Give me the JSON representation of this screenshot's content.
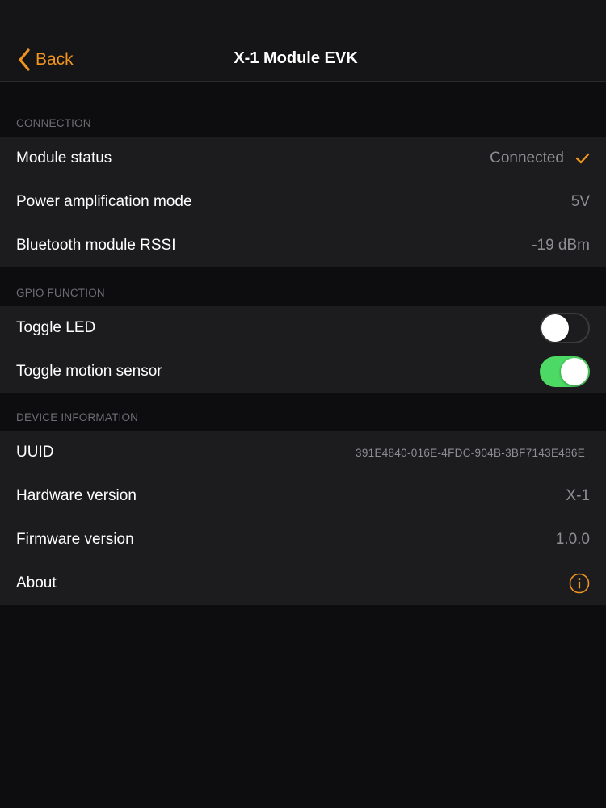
{
  "navbar": {
    "back_label": "Back",
    "title": "X-1 Module EVK"
  },
  "sections": {
    "connection": {
      "header": "CONNECTION",
      "module_status": {
        "label": "Module status",
        "value": "Connected"
      },
      "power_mode": {
        "label": "Power amplification mode",
        "value": "5V"
      },
      "rssi": {
        "label": "Bluetooth module RSSI",
        "value": "-19 dBm"
      }
    },
    "gpio": {
      "header": "GPIO FUNCTION",
      "toggle_led": {
        "label": "Toggle LED",
        "on": false
      },
      "toggle_motion": {
        "label": "Toggle motion sensor",
        "on": true
      }
    },
    "device": {
      "header": "DEVICE INFORMATION",
      "uuid": {
        "label": "UUID",
        "value": "391E4840-016E-4FDC-904B-3BF7143E486E"
      },
      "hardware": {
        "label": "Hardware version",
        "value": "X-1"
      },
      "firmware": {
        "label": "Firmware version",
        "value": "1.0.0"
      },
      "about": {
        "label": "About",
        "icon": "info-icon"
      }
    }
  },
  "colors": {
    "accent": "#f0951e",
    "switch_on": "#4cd964",
    "background": "#0d0d0f",
    "cell": "#1c1c1e"
  }
}
